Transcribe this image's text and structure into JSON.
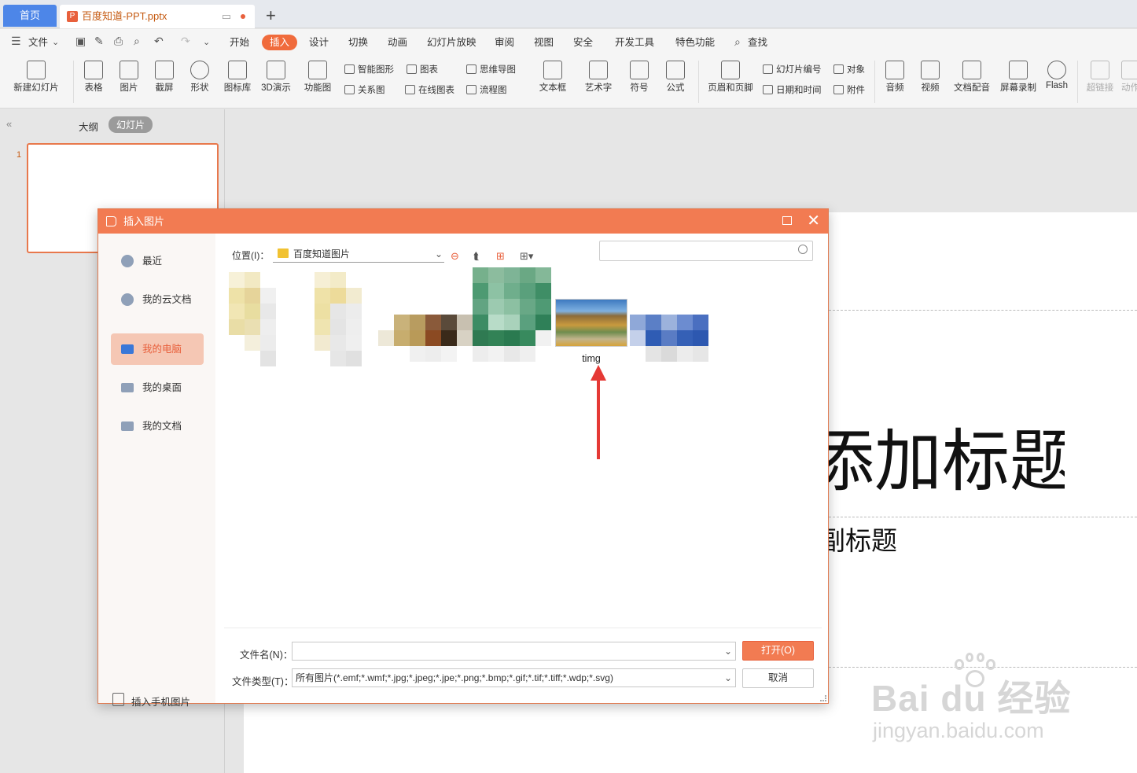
{
  "tabs": {
    "home": "首页",
    "doc": "百度知道-PPT.pptx",
    "add": "+"
  },
  "menu": {
    "file": "文件",
    "items": [
      "开始",
      "插入",
      "设计",
      "切换",
      "动画",
      "幻灯片放映",
      "审阅",
      "视图",
      "安全",
      "开发工具",
      "特色功能"
    ],
    "active": "插入",
    "search": "查找"
  },
  "ribbon": {
    "new_slide": "新建幻灯片",
    "table": "表格",
    "picture": "图片",
    "screenshot": "截屏",
    "shape": "形状",
    "icon_lib": "图标库",
    "demo3d": "3D演示",
    "func_chart": "功能图",
    "smart_shape": "智能图形",
    "chart": "图表",
    "relation": "关系图",
    "online_chart": "在线图表",
    "mindmap": "思维导图",
    "flowchart": "流程图",
    "textbox": "文本框",
    "wordart": "艺术字",
    "symbol": "符号",
    "formula": "公式",
    "header_footer": "页眉和页脚",
    "slide_number": "幻灯片编号",
    "object": "对象",
    "datetime": "日期和时间",
    "attachment": "附件",
    "audio": "音频",
    "video": "视频",
    "doc_voice": "文档配音",
    "screen_record": "屏幕录制",
    "flash": "Flash",
    "hyperlink": "超链接",
    "action": "动作"
  },
  "panel": {
    "outline": "大纲",
    "slides": "幻灯片",
    "slide_num": "1"
  },
  "slide": {
    "title_fragment": "添加标题",
    "subtitle_fragment": "副标题"
  },
  "dialog": {
    "title": "插入图片",
    "nav": [
      "最近",
      "我的云文档",
      "我的电脑",
      "我的桌面",
      "我的文档"
    ],
    "nav_selected": "我的电脑",
    "phone": "插入手机图片",
    "location_label": "位置(I)：",
    "location_value": "百度知道图片",
    "search_placeholder": "",
    "photo_name": "timg",
    "filename_label": "文件名(N)：",
    "filename_value": "",
    "filetype_label": "文件类型(T)：",
    "filetype_value": "所有图片(*.emf;*.wmf;*.jpg;*.jpeg;*.jpe;*.png;*.bmp;*.gif;*.tif;*.tiff;*.wdp;*.svg)",
    "open": "打开(O)",
    "cancel": "取消"
  },
  "watermark": {
    "brand": "Bai  du 经验",
    "url": "jingyan.baidu.com"
  },
  "colors": {
    "accent": "#f27b52",
    "tab_blue": "#4d86e8",
    "arrow": "#e53935"
  }
}
